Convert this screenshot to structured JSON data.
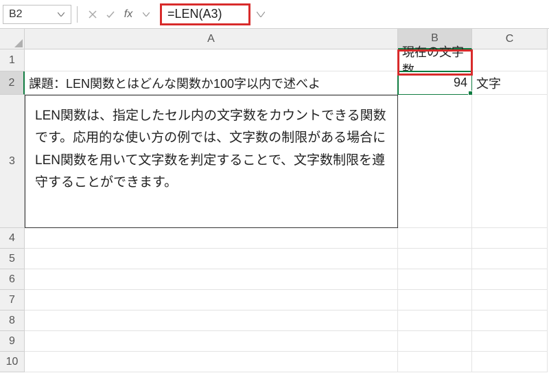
{
  "nameBox": "B2",
  "formula": "=LEN(A3)",
  "columns": [
    "A",
    "B",
    "C"
  ],
  "rows": {
    "1": {
      "B": "現在の文字数"
    },
    "2": {
      "A": "課題：LEN関数とはどんな関数か100字以内で述べよ",
      "B": "94",
      "C": "文字"
    },
    "3": {
      "A": "LEN関数は、指定したセル内の文字数をカウントできる関数です。応用的な使い方の例では、文字数の制限がある場合にLEN関数を用いて文字数を判定することで、文字数制限を遵守することができます。"
    }
  },
  "activeCell": "B2",
  "chart_data": null
}
